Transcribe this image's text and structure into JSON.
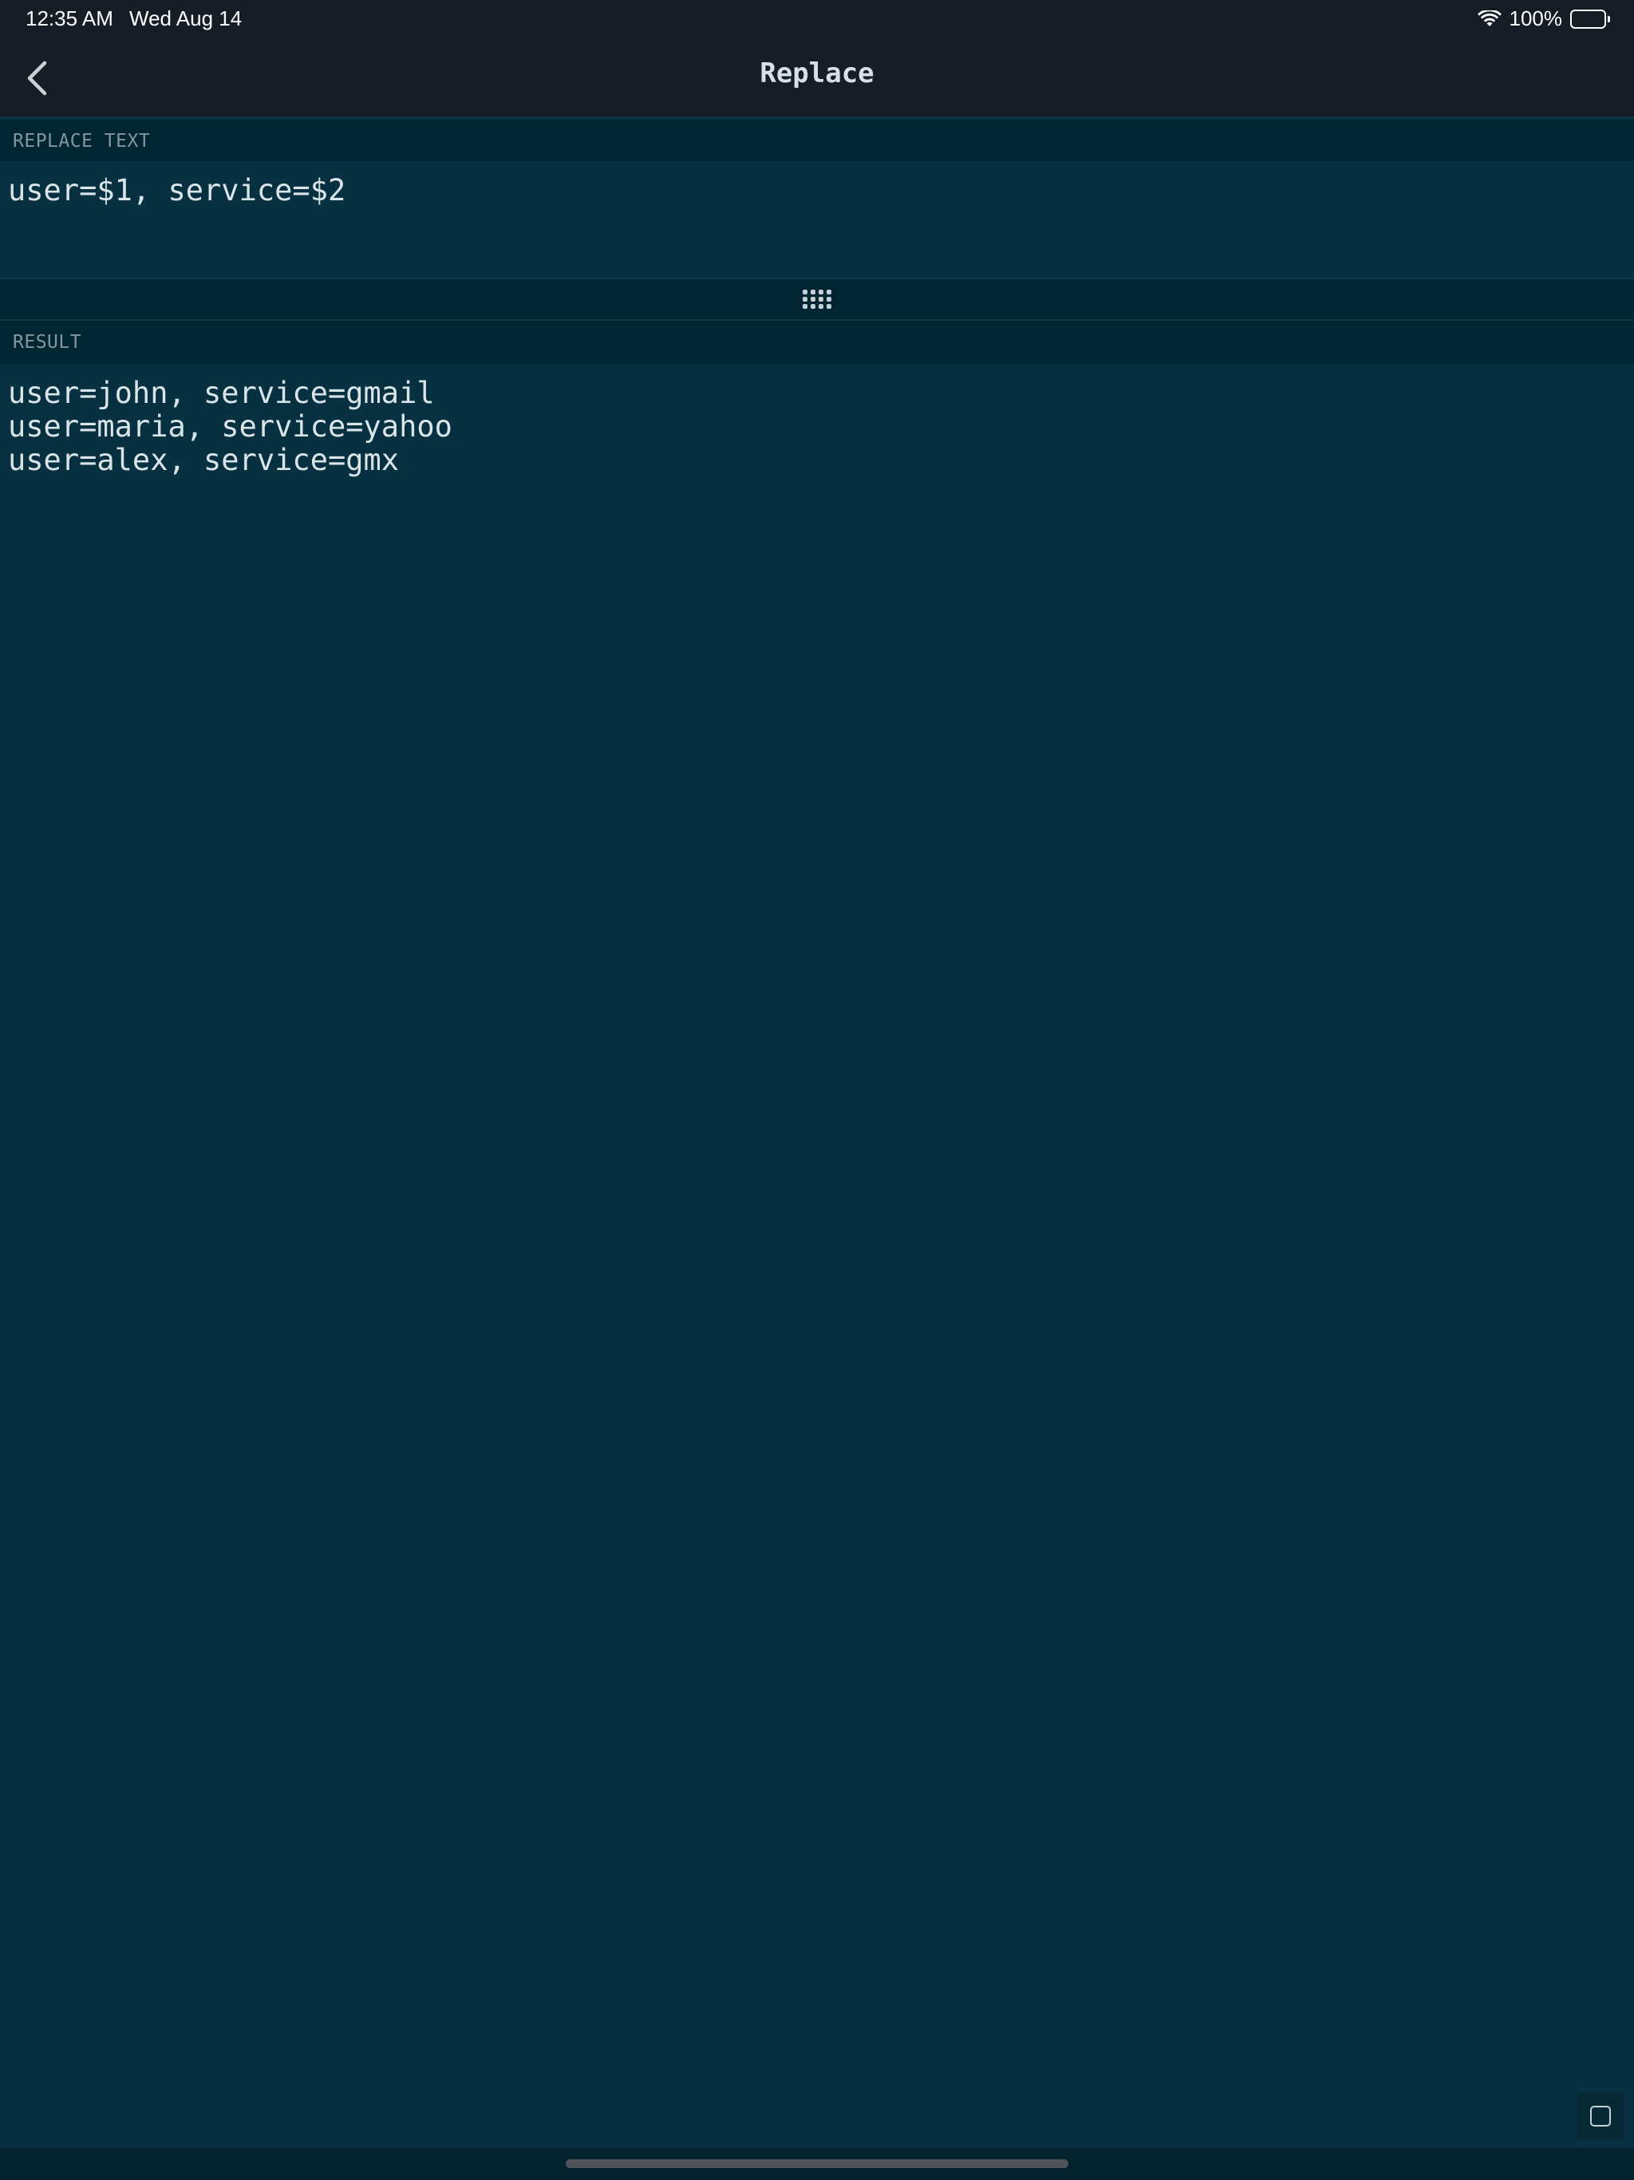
{
  "status_bar": {
    "time": "12:35 AM",
    "date": "Wed Aug 14",
    "battery_text": "100%",
    "battery_level": 1.0
  },
  "nav": {
    "title": "Replace",
    "back_icon": "chevron-left-icon"
  },
  "replace_section": {
    "header": "REPLACE TEXT",
    "value": "user=$1, service=$2"
  },
  "divider": {
    "icon": "grip-icon"
  },
  "result_section": {
    "header": "RESULT",
    "value": "user=john, service=gmail\nuser=maria, service=yahoo\nuser=alex, service=gmx"
  },
  "corner_button": {
    "icon": "square-icon"
  },
  "colors": {
    "bar_background": "#161d24",
    "editor_background": "#073140",
    "header_background": "#002634",
    "text": "#d9e4e8",
    "header_text": "#8396a0"
  }
}
